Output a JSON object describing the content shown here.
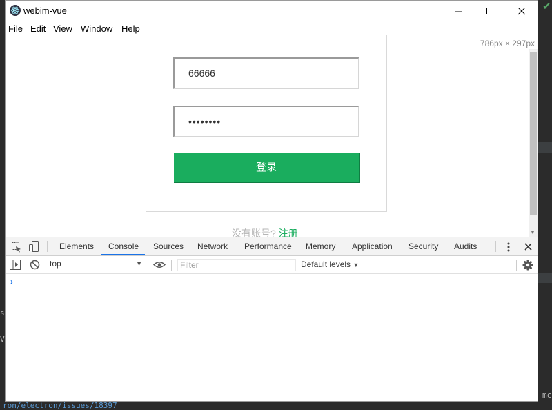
{
  "window": {
    "title": "webim-vue",
    "menu": [
      "File",
      "Edit",
      "View",
      "Window",
      "Help"
    ]
  },
  "page": {
    "dimensions": "786px × 297px",
    "username_value": "66666",
    "password_mask": "••••••••",
    "login_label": "登录",
    "register_question": "没有账号?",
    "register_link": "注册"
  },
  "devtools": {
    "tabs": [
      "Elements",
      "Console",
      "Sources",
      "Network",
      "Performance",
      "Memory",
      "Application",
      "Security",
      "Audits"
    ],
    "active_tab": "Console",
    "context": "top",
    "filter_placeholder": "Filter",
    "levels_label": "Default levels",
    "prompt": "›"
  },
  "background": {
    "status_link": "ron/electron/issues/18397",
    "side_letters": [
      "s",
      "V"
    ],
    "right_letters": "mc"
  },
  "colors": {
    "accent_green": "#1aad5e",
    "devtools_blue": "#1a73e8"
  }
}
